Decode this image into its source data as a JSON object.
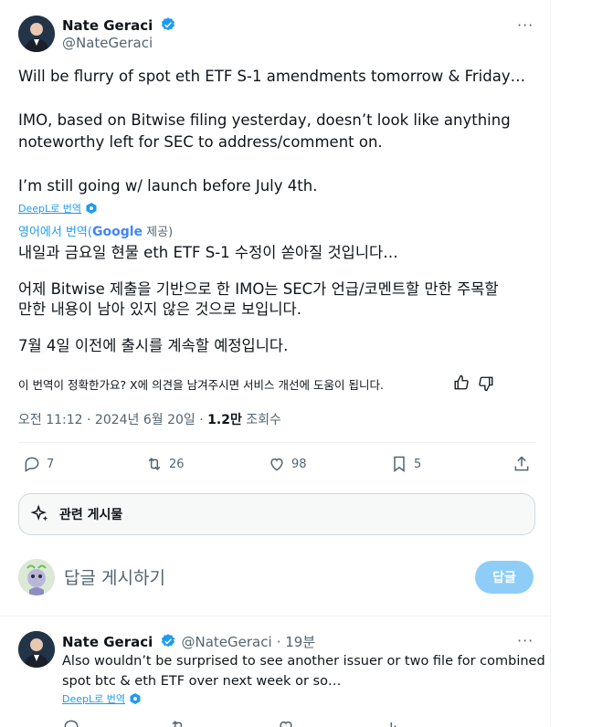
{
  "tweet": {
    "author_name": "Nate Geraci",
    "author_handle": "@NateGeraci",
    "body_en": [
      "Will be flurry of spot eth ETF S-1 amendments tomorrow & Friday…",
      "IMO, based on Bitwise filing yesterday, doesn’t look like anything",
      "noteworthy left for SEC to address/comment on.",
      "I’m still going w/ launch before July 4th."
    ],
    "deepl_label": "DeepL로 번역",
    "translated_from_prefix": "영어에서 번역(",
    "google_label": "Google",
    "translated_suffix": " 제공)",
    "body_ko": [
      "내일과 금요일 현물 eth ETF S-1 수정이 쏟아질 것입니다…",
      "어제 Bitwise 제출을 기반으로 한 IMO는 SEC가 언급/코멘트할 만한 주목할",
      "만한 내용이 남아 있지 않은 것으로 보입니다.",
      "7월 4일 이전에 출시를 계속할 예정입니다."
    ],
    "feedback_question": "이 번역이 정확한가요? X에 의견을 남겨주시면 서비스 개선에 도움이 됩니다.",
    "time": "오전 11:12 · 2024년 6월 20일 · ",
    "views_count": "1.2만",
    "views_label": " 조회수",
    "actions": {
      "replies": "7",
      "reposts": "26",
      "likes": "98",
      "bookmarks": "5"
    },
    "more_label": "···"
  },
  "related": {
    "label": "관련 게시물"
  },
  "composer": {
    "placeholder": "답글 게시하기",
    "reply_button": "답글"
  },
  "reply": {
    "author_name": "Nate Geraci",
    "author_handle": "@NateGeraci",
    "time": "· 19분",
    "body": [
      "Also wouldn’t be surprised to see another issuer or two file for combined",
      "spot btc & eth ETF over next week or so…"
    ],
    "deepl_label": "DeepL로 번역",
    "more_label": "···"
  },
  "colors": {
    "accent": "#1d9bf0",
    "reply_button_disabled": "#8ecdf7",
    "text_secondary": "#536471"
  }
}
